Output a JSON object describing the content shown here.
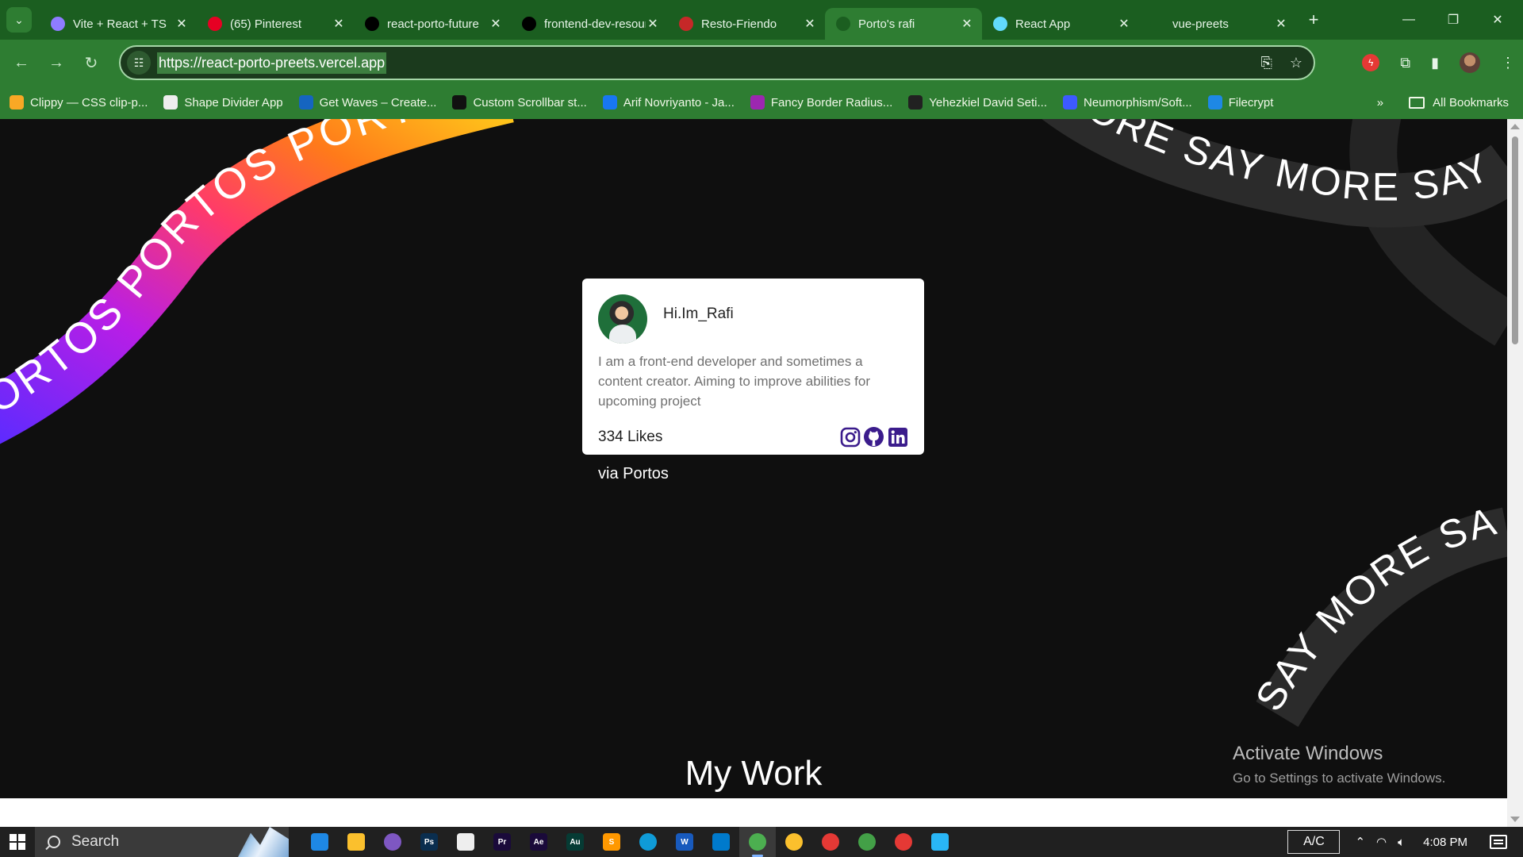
{
  "browser": {
    "tabs": [
      {
        "title": "Vite + React + TS",
        "favicon": "vite-icon",
        "color": "#8e7cff",
        "active": false
      },
      {
        "title": "(65) Pinterest",
        "favicon": "pinterest-icon",
        "color": "#e60023",
        "active": false
      },
      {
        "title": "react-porto-future",
        "favicon": "vercel-icon",
        "color": "#000000",
        "active": false
      },
      {
        "title": "frontend-dev-resources",
        "favicon": "vercel-icon",
        "color": "#000000",
        "active": false
      },
      {
        "title": "Resto-Friendo",
        "favicon": "fork-icon",
        "color": "#c62828",
        "active": false
      },
      {
        "title": "Porto's rafi",
        "favicon": "page-icon",
        "color": "#1b5e20",
        "active": true
      },
      {
        "title": "React App",
        "favicon": "react-icon",
        "color": "#61dafb",
        "active": false
      },
      {
        "title": "vue-preets",
        "favicon": "page-icon",
        "color": "#1b5e20",
        "active": false
      }
    ],
    "new_tab_label": "+",
    "url": "https://react-porto-preets.vercel.app",
    "bookmarks": [
      {
        "label": "Clippy — CSS clip-p...",
        "icon": "clippy-icon",
        "color": "#f9a825"
      },
      {
        "label": "Shape Divider App",
        "icon": "shape-divider-icon",
        "color": "#eeeeee"
      },
      {
        "label": "Get Waves – Create...",
        "icon": "waves-icon",
        "color": "#1565c0"
      },
      {
        "label": "Custom Scrollbar st...",
        "icon": "codepen-icon",
        "color": "#111111"
      },
      {
        "label": "Arif Novriyanto - Ja...",
        "icon": "facebook-icon",
        "color": "#1877f2"
      },
      {
        "label": "Fancy Border Radius...",
        "icon": "fancy-border-icon",
        "color": "#9c27b0"
      },
      {
        "label": "Yehezkiel David Seti...",
        "icon": "diamond-icon",
        "color": "#212121"
      },
      {
        "label": "Neumorphism/Soft...",
        "icon": "neumorphism-icon",
        "color": "#3d5afe"
      },
      {
        "label": "Filecrypt",
        "icon": "shield-icon",
        "color": "#1e88e5"
      }
    ],
    "bookmarks_overflow": "»",
    "all_bookmarks_label": "All Bookmarks"
  },
  "page": {
    "ribbon_left_text": "PORTOS PORTOS PORTOS PORTOS",
    "ribbon_right_text_1": "MORE  SAY MORE  SAY MORE",
    "ribbon_right_text_2": "SAY MORE SA",
    "card": {
      "name": "Hi.Im_Rafi",
      "bio": "I am a front-end developer and sometimes a content creator. Aiming to improve abilities for upcoming project",
      "likes": "334 Likes",
      "socials": [
        "instagram-icon",
        "github-icon",
        "linkedin-icon"
      ],
      "social_color": "#3b1c8c"
    },
    "via": "via Portos",
    "section_heading": "My Work",
    "watermark_title": "Activate Windows",
    "watermark_subtitle": "Go to Settings to activate Windows."
  },
  "taskbar": {
    "search_label": "Search",
    "apps": [
      {
        "icon": "mail-icon",
        "color": "#1e88e5",
        "label": ""
      },
      {
        "icon": "file-explorer-icon",
        "color": "#fbc02d",
        "label": ""
      },
      {
        "icon": "app-orb-icon",
        "color": "#7e57c2",
        "label": ""
      },
      {
        "icon": "photoshop-icon",
        "color": "#0a2e4f",
        "label": "Ps"
      },
      {
        "icon": "notes-icon",
        "color": "#eeeeee",
        "label": ""
      },
      {
        "icon": "premiere-icon",
        "color": "#1a0a3a",
        "label": "Pr"
      },
      {
        "icon": "after-effects-icon",
        "color": "#1a0a3a",
        "label": "Ae"
      },
      {
        "icon": "audition-icon",
        "color": "#063b34",
        "label": "Au"
      },
      {
        "icon": "sublime-icon",
        "color": "#ff9800",
        "label": "S"
      },
      {
        "icon": "edge-icon",
        "color": "#0f9bd7",
        "label": ""
      },
      {
        "icon": "word-icon",
        "color": "#185abd",
        "label": "W"
      },
      {
        "icon": "vscode-icon",
        "color": "#007acc",
        "label": ""
      },
      {
        "icon": "chrome-icon",
        "color": "#4caf50",
        "label": "",
        "active": true
      },
      {
        "icon": "chrome-icon",
        "color": "#fbc02d",
        "label": ""
      },
      {
        "icon": "chrome-icon",
        "color": "#e53935",
        "label": ""
      },
      {
        "icon": "chrome-icon",
        "color": "#43a047",
        "label": ""
      },
      {
        "icon": "chrome-icon",
        "color": "#e53935",
        "label": ""
      },
      {
        "icon": "paint-icon",
        "color": "#29b6f6",
        "label": ""
      }
    ],
    "ac_label": "A/C",
    "clock": "4:08 PM"
  }
}
